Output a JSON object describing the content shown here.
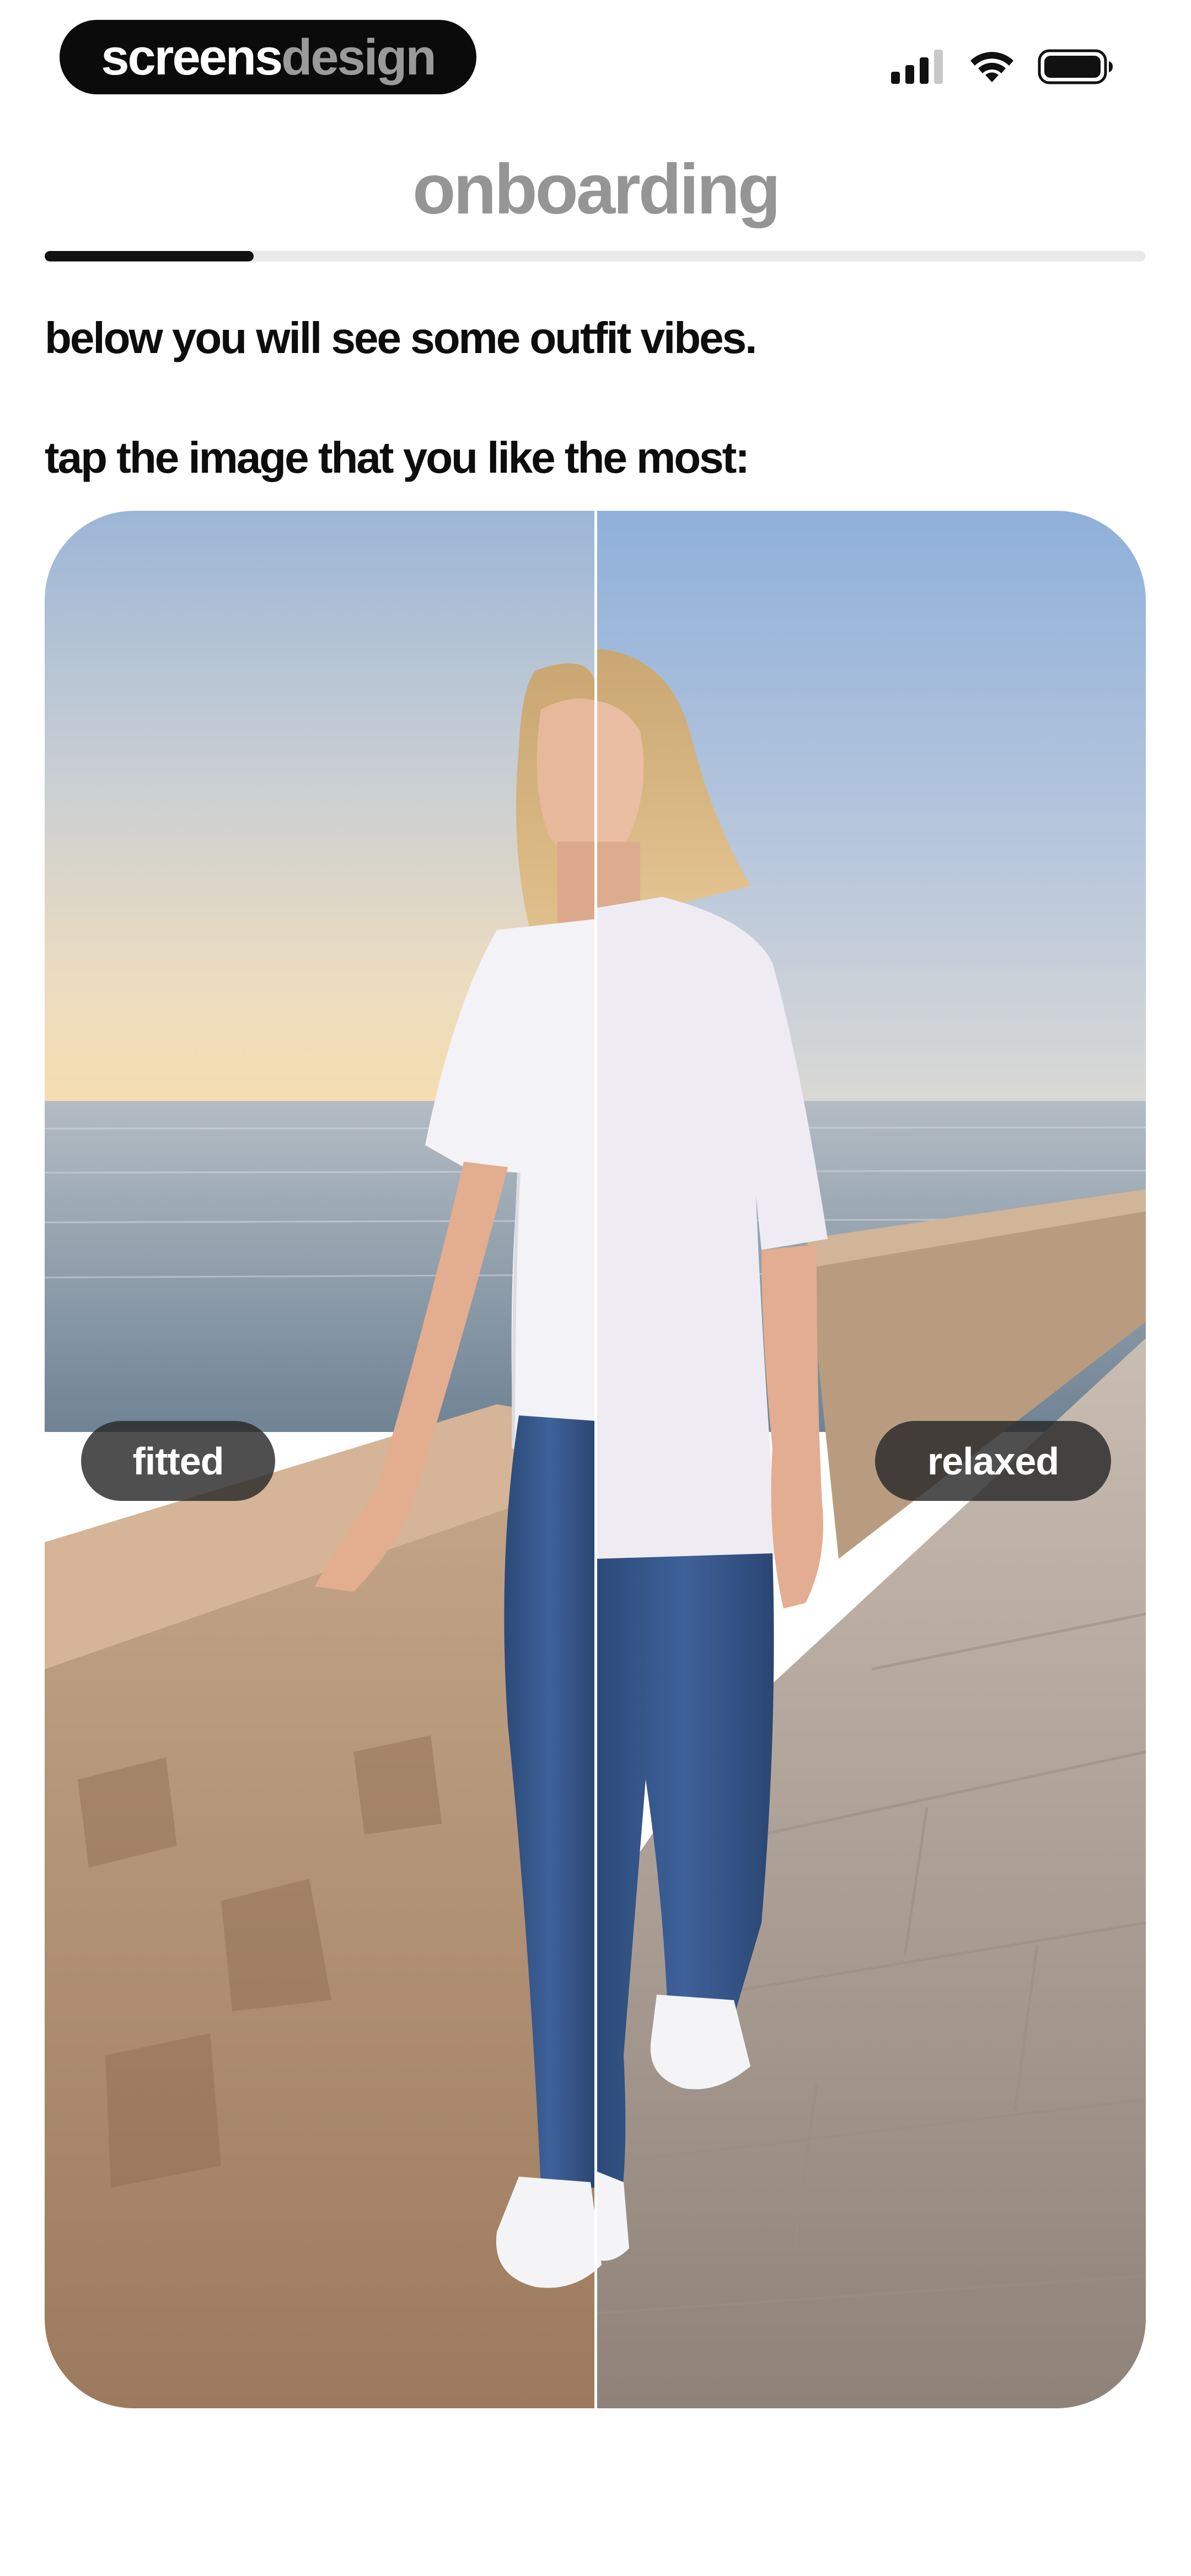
{
  "status_bar": {
    "brand_part_1": "screens",
    "brand_part_2": "design",
    "icons": [
      "cellular-signal-icon",
      "wifi-icon",
      "battery-icon"
    ]
  },
  "header": {
    "title": "onboarding",
    "progress_fraction": 0.19
  },
  "instructions": {
    "line_1": "below you will see some outfit vibes.",
    "line_2": "tap the image that you like the most:"
  },
  "comparison": {
    "left_option": "fitted",
    "right_option": "relaxed"
  },
  "colors": {
    "title_gray": "#959595",
    "progress_fill": "#111111",
    "progress_track": "#e9e9e9",
    "label_pill": "#282828"
  }
}
